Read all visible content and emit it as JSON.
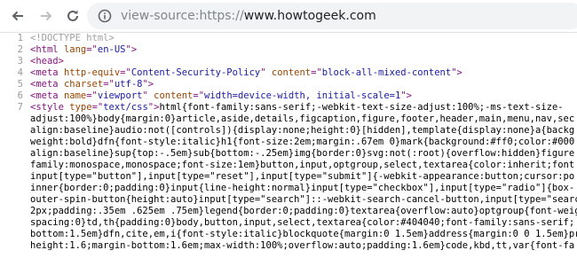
{
  "browser": {
    "url_scheme": "view-source:https://",
    "url_domain": "www.howtogeek.com",
    "icons": [
      "back-arrow-icon",
      "forward-arrow-icon",
      "reload-icon",
      "info-icon"
    ]
  },
  "source": {
    "lines": [
      {
        "num": "1",
        "parts": [
          {
            "t": "<!DOCTYPE html>",
            "c": "doctype"
          }
        ]
      },
      {
        "num": "2",
        "parts": [
          {
            "t": "<html ",
            "c": "tag"
          },
          {
            "t": "lang",
            "c": "attr"
          },
          {
            "t": "=\"",
            "c": "tag"
          },
          {
            "t": "en-US",
            "c": "val"
          },
          {
            "t": "\">",
            "c": "tag"
          }
        ]
      },
      {
        "num": "3",
        "parts": [
          {
            "t": "<head>",
            "c": "tag"
          }
        ]
      },
      {
        "num": "4",
        "parts": [
          {
            "t": "<meta ",
            "c": "tag"
          },
          {
            "t": "http-equiv",
            "c": "attr"
          },
          {
            "t": "=\"",
            "c": "tag"
          },
          {
            "t": "Content-Security-Policy",
            "c": "val"
          },
          {
            "t": "\" ",
            "c": "tag"
          },
          {
            "t": "content",
            "c": "attr"
          },
          {
            "t": "=\"",
            "c": "tag"
          },
          {
            "t": "block-all-mixed-content",
            "c": "val"
          },
          {
            "t": "\">",
            "c": "tag"
          }
        ]
      },
      {
        "num": "5",
        "parts": [
          {
            "t": "<meta ",
            "c": "tag"
          },
          {
            "t": "charset",
            "c": "attr"
          },
          {
            "t": "=\"",
            "c": "tag"
          },
          {
            "t": "utf-8",
            "c": "val"
          },
          {
            "t": "\">",
            "c": "tag"
          }
        ]
      },
      {
        "num": "6",
        "parts": [
          {
            "t": "<meta ",
            "c": "tag"
          },
          {
            "t": "name",
            "c": "attr"
          },
          {
            "t": "=\"",
            "c": "tag"
          },
          {
            "t": "viewport",
            "c": "val"
          },
          {
            "t": "\" ",
            "c": "tag"
          },
          {
            "t": "content",
            "c": "attr"
          },
          {
            "t": "=\"",
            "c": "tag"
          },
          {
            "t": "width=device-width, initial-scale=1",
            "c": "val"
          },
          {
            "t": "\">",
            "c": "tag"
          }
        ]
      },
      {
        "num": "7",
        "parts": [
          {
            "t": "<style ",
            "c": "tag"
          },
          {
            "t": "type",
            "c": "attr"
          },
          {
            "t": "=\"",
            "c": "tag"
          },
          {
            "t": "text/css",
            "c": "val"
          },
          {
            "t": "\">",
            "c": "tag"
          },
          {
            "t": "html{font-family:sans-serif;-webkit-text-size-adjust:100%;-ms-text-size-",
            "c": "css"
          }
        ]
      },
      {
        "num": "",
        "parts": [
          {
            "t": "adjust:100%}body{margin:0}article,aside,details,figcaption,figure,footer,header,main,menu,nav,sec",
            "c": "css"
          }
        ]
      },
      {
        "num": "",
        "parts": [
          {
            "t": "align:baseline}audio:not([controls]){display:none;height:0}[hidden],template{display:none}a{backg",
            "c": "css"
          }
        ]
      },
      {
        "num": "",
        "parts": [
          {
            "t": "weight:bold}dfn{font-style:italic}h1{font-size:2em;margin:.67em 0}mark{background:#ff0;color:#000",
            "c": "css"
          }
        ]
      },
      {
        "num": "",
        "parts": [
          {
            "t": "align:baseline}sup{top:-.5em}sub{bottom:-.25em}img{border:0}svg:not(:root){overflow:hidden}figure",
            "c": "css"
          }
        ]
      },
      {
        "num": "",
        "parts": [
          {
            "t": "family:monospace,monospace;font-size:1em}button,input,optgroup,select,textarea{color:inherit;font",
            "c": "css"
          }
        ]
      },
      {
        "num": "",
        "parts": [
          {
            "t": "input[type=\"button\"],input[type=\"reset\"],input[type=\"submit\"]{-webkit-appearance:button;cursor:po",
            "c": "css"
          }
        ]
      },
      {
        "num": "",
        "parts": [
          {
            "t": "inner{border:0;padding:0}input{line-height:normal}input[type=\"checkbox\"],input[type=\"radio\"]{box-",
            "c": "css"
          }
        ]
      },
      {
        "num": "",
        "parts": [
          {
            "t": "outer-spin-button{height:auto}input[type=\"search\"]::-webkit-search-cancel-button,input[type=\"search",
            "c": "css"
          }
        ]
      },
      {
        "num": "",
        "parts": [
          {
            "t": "2px;padding:.35em .625em .75em}legend{border:0;padding:0}textarea{overflow:auto}optgroup{font-weig",
            "c": "css"
          }
        ]
      },
      {
        "num": "",
        "parts": [
          {
            "t": "spacing:0}td,th{padding:0}body,button,input,select,textarea{color:#404040;font-family:sans-serif;",
            "c": "css"
          }
        ]
      },
      {
        "num": "",
        "parts": [
          {
            "t": "bottom:1.5em}dfn,cite,em,i{font-style:italic}blockquote{margin:0 1.5em}address{margin:0 0 1.5em}pr",
            "c": "css"
          }
        ]
      },
      {
        "num": "",
        "parts": [
          {
            "t": "height:1.6;margin-bottom:1.6em;max-width:100%;overflow:auto;padding:1.6em}code,kbd,tt,var{font-fa",
            "c": "css"
          }
        ]
      }
    ]
  }
}
